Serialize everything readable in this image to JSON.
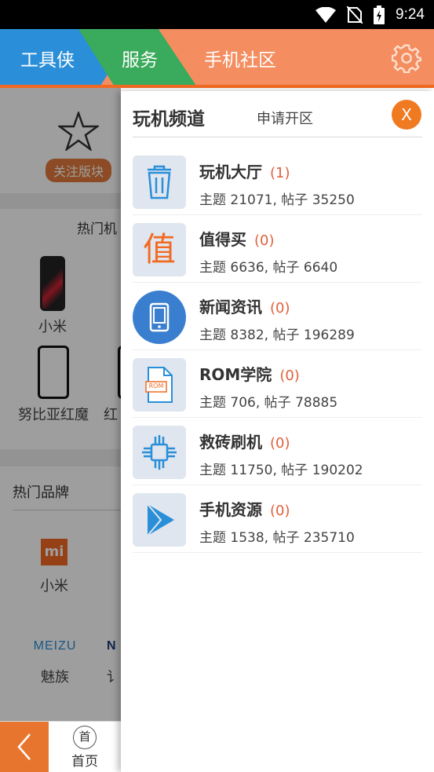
{
  "status_bar": {
    "time": "9:24"
  },
  "header": {
    "tabs": [
      {
        "label": "工具侠",
        "color": "#2a8fd8"
      },
      {
        "label": "服务",
        "color": "#3aaa5c"
      },
      {
        "label": "手机社区",
        "color": "#f48d5f"
      }
    ],
    "settings_icon": "gear-icon"
  },
  "background_page": {
    "follow_label": "关注版块",
    "hot_phones_title": "热门机",
    "phones": [
      {
        "label": "小米"
      },
      {
        "label": "努比亚红魔"
      },
      {
        "label": "红"
      }
    ],
    "hot_brands_title": "热门品牌",
    "brands": [
      {
        "label": "小米",
        "logo_text": "mi"
      },
      {
        "label": "魅族",
        "logo_text": "MEIZU"
      },
      {
        "label": "讠",
        "logo_text": "N"
      }
    ],
    "bottom_nav": {
      "home_circle": "首",
      "home_label": "首页"
    }
  },
  "drawer": {
    "title": "玩机频道",
    "apply_label": "申请开区",
    "close_label": "X",
    "channels": [
      {
        "name": "玩机大厅",
        "count": "(1)",
        "stats": "主题 21071, 帖子 35250",
        "icon": "trash-icon"
      },
      {
        "name": "值得买",
        "count": "(0)",
        "stats": "主题 6636, 帖子 6640",
        "icon": "value-icon",
        "icon_text": "值"
      },
      {
        "name": "新闻资讯",
        "count": "(0)",
        "stats": "主题 8382, 帖子 196289",
        "icon": "phone-icon"
      },
      {
        "name": "ROM学院",
        "count": "(0)",
        "stats": "主题 706, 帖子 78885",
        "icon": "rom-file-icon",
        "icon_text": "ROM"
      },
      {
        "name": "救砖刷机",
        "count": "(0)",
        "stats": "主题 11750, 帖子 190202",
        "icon": "chip-icon"
      },
      {
        "name": "手机资源",
        "count": "(0)",
        "stats": "主题 1538, 帖子 235710",
        "icon": "play-icon"
      }
    ]
  },
  "colors": {
    "accent": "#f07a22",
    "count_red": "#e0603a",
    "icon_blue": "#2a8fd8"
  }
}
